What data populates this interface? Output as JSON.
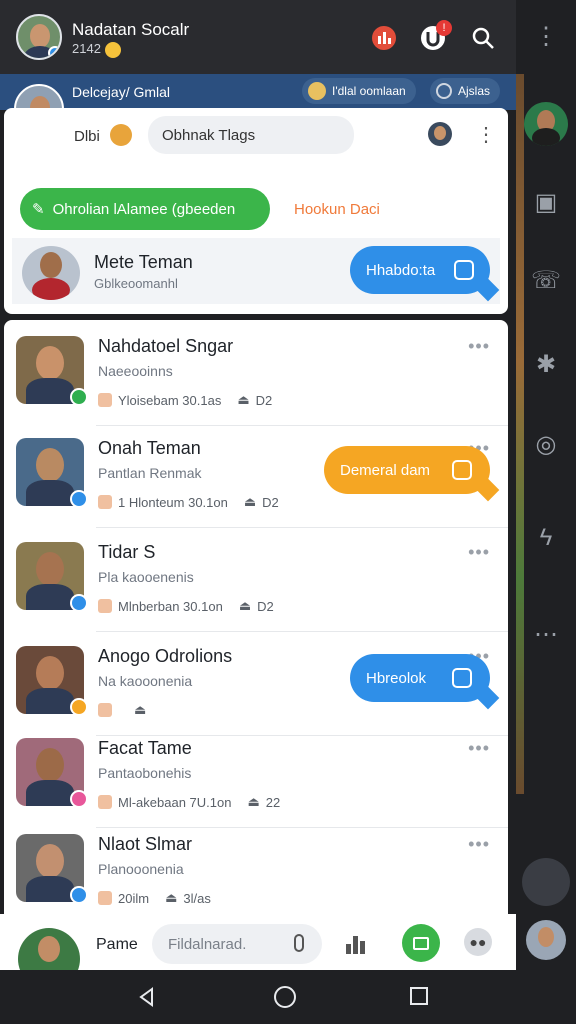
{
  "header": {
    "title": "Nadatan Socalr",
    "subtitle": "2142",
    "icons": [
      "chart-icon",
      "notification-icon",
      "search-icon"
    ],
    "notification_badge": "!",
    "menu_icon": "more-vertical-icon"
  },
  "strip": {
    "label": "Delcejay/ Gmlal",
    "chip_one": "I'dlal oomlaan",
    "chip_two": "Ajslas"
  },
  "compose_card": {
    "prefix": "Dlbi",
    "search_placeholder": "Obhnak Tlags",
    "green_pill": "Ohrolian lAlamee (gbeeden",
    "orange_link": "Hookun Daci",
    "contact_name": "Mete Teman",
    "contact_sub": "Gblkeoomanhl",
    "contact_button": "Hhabdo:ta"
  },
  "chats": [
    {
      "name": "Nahdatoel Sngar",
      "sub": "Naeeooinns",
      "meta": "Yloisebam 30.1as",
      "count": "D2",
      "bubble": "",
      "bubble_color": "",
      "badge_color": "#2fae4f"
    },
    {
      "name": "Onah Teman",
      "sub": "Pantlan Renmak",
      "meta": "1 Hlonteum 30.1on",
      "count": "D2",
      "bubble": "Demeral dam",
      "bubble_color": "#f5a623",
      "badge_color": "#2f8fe8"
    },
    {
      "name": "Tidar S",
      "sub": "Pla kaooenenis",
      "meta": "Mlnberban 30.1on",
      "count": "D2",
      "bubble": "",
      "bubble_color": "",
      "badge_color": "#2f8fe8"
    },
    {
      "name": "Anogo Odrolions",
      "sub": "Na kaooonenia",
      "meta": "",
      "count": "",
      "bubble": "Hbreolok",
      "bubble_color": "#2f8fe8",
      "badge_color": "#f5a623"
    },
    {
      "name": "Facat Tame",
      "sub": "Pantaobonehis",
      "meta": "Ml-akebaan 7U.1on",
      "count": "22",
      "bubble": "",
      "bubble_color": "",
      "badge_color": "#e8579a"
    },
    {
      "name": "Nlaot Slmar",
      "sub": "Planooonenia",
      "meta": "20ilm",
      "count": "3l/as",
      "bubble": "",
      "bubble_color": "",
      "badge_color": "#2f8fe8"
    }
  ],
  "composer": {
    "label": "Pame",
    "input_placeholder": "Fildalnarad.",
    "icons": [
      "microphone-icon",
      "bar-chart-icon",
      "image-icon",
      "more-icon"
    ]
  },
  "navbar": {
    "icons": [
      "back-icon",
      "home-icon",
      "recents-icon"
    ]
  },
  "colors": {
    "topbar": "#2a2b2f",
    "strip": "#2b4f7f",
    "green": "#3bb54a",
    "blue": "#2f8fe8",
    "orange": "#f5a623"
  }
}
